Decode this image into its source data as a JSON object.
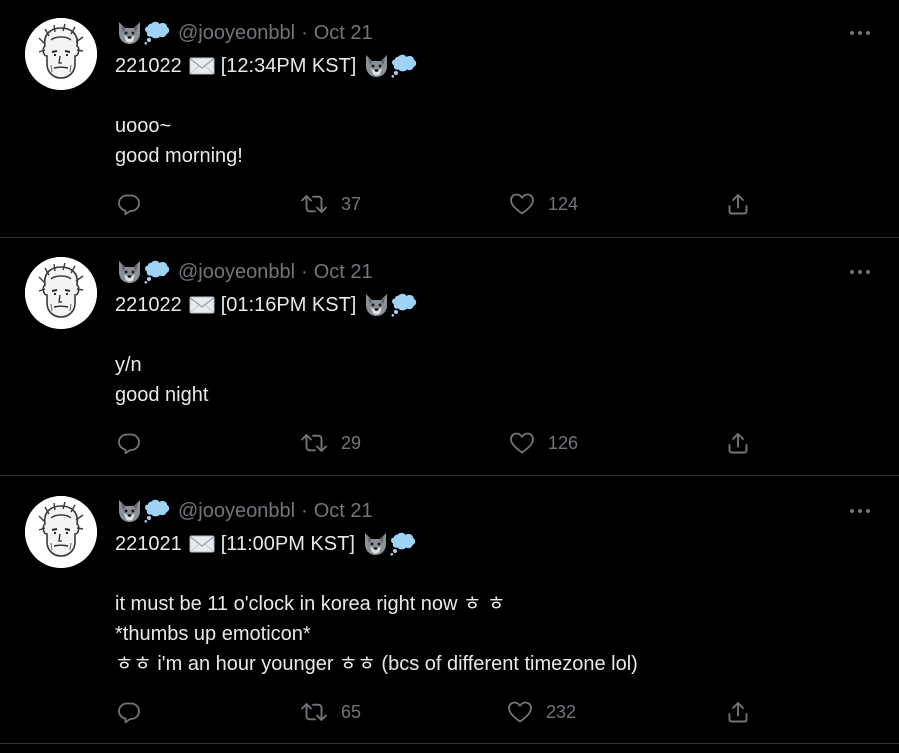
{
  "tweets": [
    {
      "handle": "@jooyeonbbl",
      "separator": "·",
      "date": "Oct 21",
      "line1_prefix": "221022",
      "line1_suffix": "[12:34PM KST]",
      "body": [
        "uooo~",
        "good morning!"
      ],
      "retweets": "37",
      "likes": "124"
    },
    {
      "handle": "@jooyeonbbl",
      "separator": "·",
      "date": "Oct 21",
      "line1_prefix": "221022",
      "line1_suffix": "[01:16PM KST]",
      "body": [
        "y/n",
        "good night"
      ],
      "retweets": "29",
      "likes": "126"
    },
    {
      "handle": "@jooyeonbbl",
      "separator": "·",
      "date": "Oct 21",
      "line1_prefix": "221021",
      "line1_suffix": "[11:00PM KST]",
      "body": [
        "it must be 11 o'clock in korea right now ㅎ ㅎ",
        "*thumbs up emoticon*",
        "ㅎㅎ i'm an hour younger ㅎㅎ (bcs of different timezone lol)"
      ],
      "retweets": "65",
      "likes": "232"
    }
  ],
  "icons": {
    "emoji_1": "wolf-emoji-icon",
    "emoji_2": "thought-balloon-emoji-icon",
    "mail": "envelope-emoji-icon",
    "more": "more-options-icon",
    "reply": "reply-icon",
    "retweet": "retweet-icon",
    "like": "heart-icon",
    "share": "share-icon"
  },
  "colors": {
    "background": "#000000",
    "text_primary": "#e7e9ea",
    "text_secondary": "#71767b",
    "divider": "#2f3336",
    "balloon": "#9fd3f5"
  }
}
